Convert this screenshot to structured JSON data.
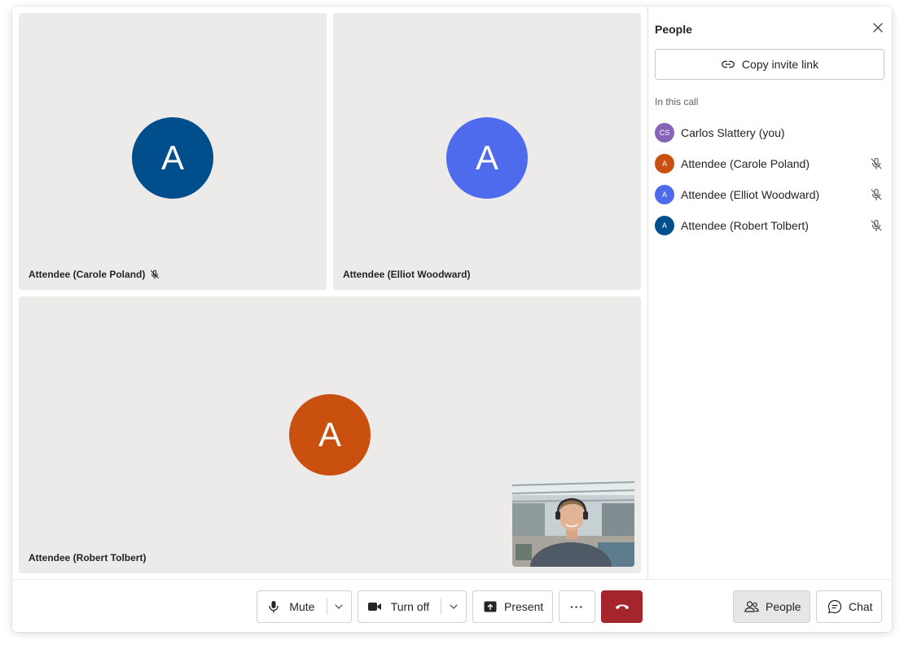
{
  "tiles": [
    {
      "initial": "A",
      "name": "Attendee (Carole Poland)",
      "avatar_color": "#004e8c",
      "muted": true
    },
    {
      "initial": "A",
      "name": "Attendee (Elliot Woodward)",
      "avatar_color": "#4f6bed",
      "muted": false
    },
    {
      "initial": "A",
      "name": "Attendee (Robert Tolbert)",
      "avatar_color": "#ca5010",
      "muted": false
    }
  ],
  "panel": {
    "title": "People",
    "invite_label": "Copy invite link",
    "section_label": "In this call",
    "people": [
      {
        "initials": "CS",
        "name": "Carlos Slattery (you)",
        "color": "#8764b8",
        "muted": false
      },
      {
        "initials": "A",
        "name": "Attendee (Carole Poland)",
        "color": "#ca5010",
        "muted": true
      },
      {
        "initials": "A",
        "name": "Attendee (Elliot Woodward)",
        "color": "#4f6bed",
        "muted": true
      },
      {
        "initials": "A",
        "name": "Attendee (Robert Tolbert)",
        "color": "#004e8c",
        "muted": true
      }
    ]
  },
  "toolbar": {
    "mute_label": "Mute",
    "video_label": "Turn off",
    "present_label": "Present",
    "more_label": "···",
    "people_label": "People",
    "chat_label": "Chat"
  },
  "colors": {
    "tile_bg": "#edebe9",
    "leave": "#a4262c"
  },
  "icons": [
    "mic-icon",
    "mic-off-icon",
    "video-camera-icon",
    "present-icon",
    "more-icon",
    "hang-up-icon",
    "people-icon",
    "chat-icon",
    "link-icon",
    "close-icon",
    "chevron-down-icon"
  ]
}
